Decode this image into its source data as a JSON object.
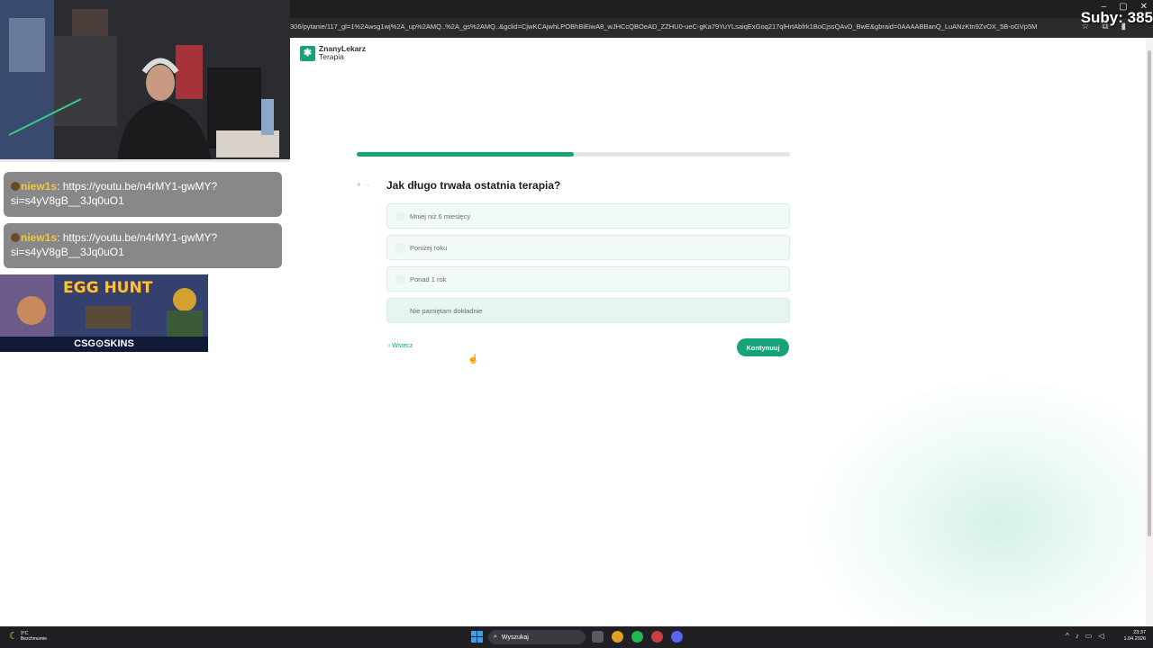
{
  "browser": {
    "url": "306/pytanie/117_gl=1%2Awsg1wj%2A_up%2AMQ..%2A_gs%2AMQ..&gclid=CjwKCAjwhLPOBhBiEiwA8_wJHCcQBOeAD_ZZHU0-ueC-gKa79YuYLsaiqExGoq217qlHrtAbfrk1BoCjssQAvD_BwE&gbraid=0AAAABBanQ_LuANzKtn9ZvOX_5B-oGVp5M"
  },
  "overlay": {
    "subs": "Suby: 385",
    "chat": [
      {
        "user": "niew1s",
        "line1": ": https://youtu.be/n4rMY1-gwMY?",
        "line2": "si=s4yV8gB__3Jq0uO1"
      },
      {
        "user": "niew1s",
        "line1": ": https://youtu.be/n4rMY1-gwMY?",
        "line2": "si=s4yV8gB__3Jq0uO1"
      }
    ],
    "ad": {
      "title": "EGG HUNT",
      "brand": "CSG⊙SKINS"
    }
  },
  "page": {
    "logo_line1": "ZnanyLekarz",
    "logo_line2": "Terapia",
    "progress": 0.5,
    "question": "Jak długo trwała ostatnia terapia?",
    "options": [
      "Mniej niż 6 miesięcy",
      "Poniżej roku",
      "Ponad 1 rok",
      "Nie pamiętam dokładnie"
    ],
    "back_label": "Wstecz",
    "continue_label": "Kontynuuj",
    "accent_color": "#17a37a"
  },
  "taskbar": {
    "weather_temp": "3°C",
    "weather_desc": "Bezchmurnie",
    "search_placeholder": "Wyszukaj",
    "time": "23:37",
    "date": "1.04.2026"
  }
}
